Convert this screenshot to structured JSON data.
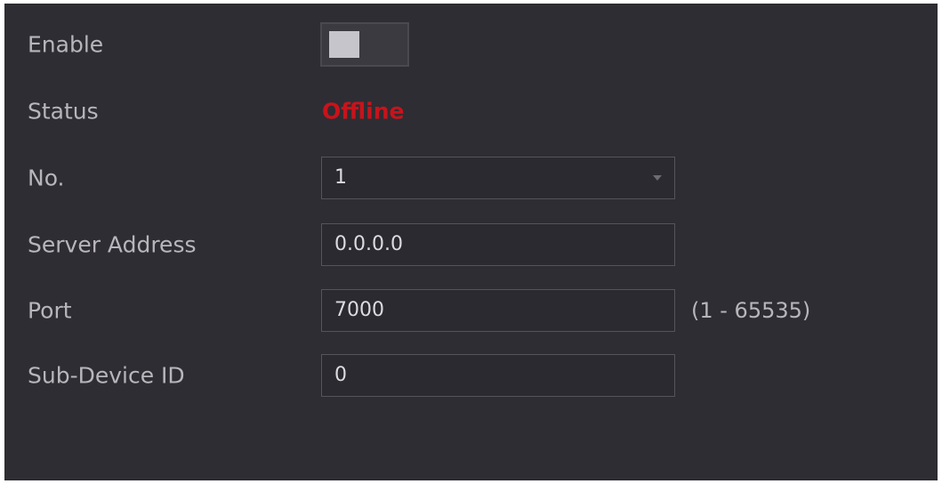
{
  "form": {
    "enable": {
      "label": "Enable",
      "value": false
    },
    "status": {
      "label": "Status",
      "value": "Offline",
      "color": "#c8131b"
    },
    "no": {
      "label": "No.",
      "value": "1"
    },
    "server_address": {
      "label": "Server Address",
      "value": "0.0.0.0"
    },
    "port": {
      "label": "Port",
      "value": "7000",
      "hint": "(1 - 65535)"
    },
    "sub_device_id": {
      "label": "Sub-Device ID",
      "value": "0"
    }
  },
  "colors": {
    "background": "#2e2d33",
    "label_text": "#b7b6bb",
    "field_border": "#55545a"
  }
}
